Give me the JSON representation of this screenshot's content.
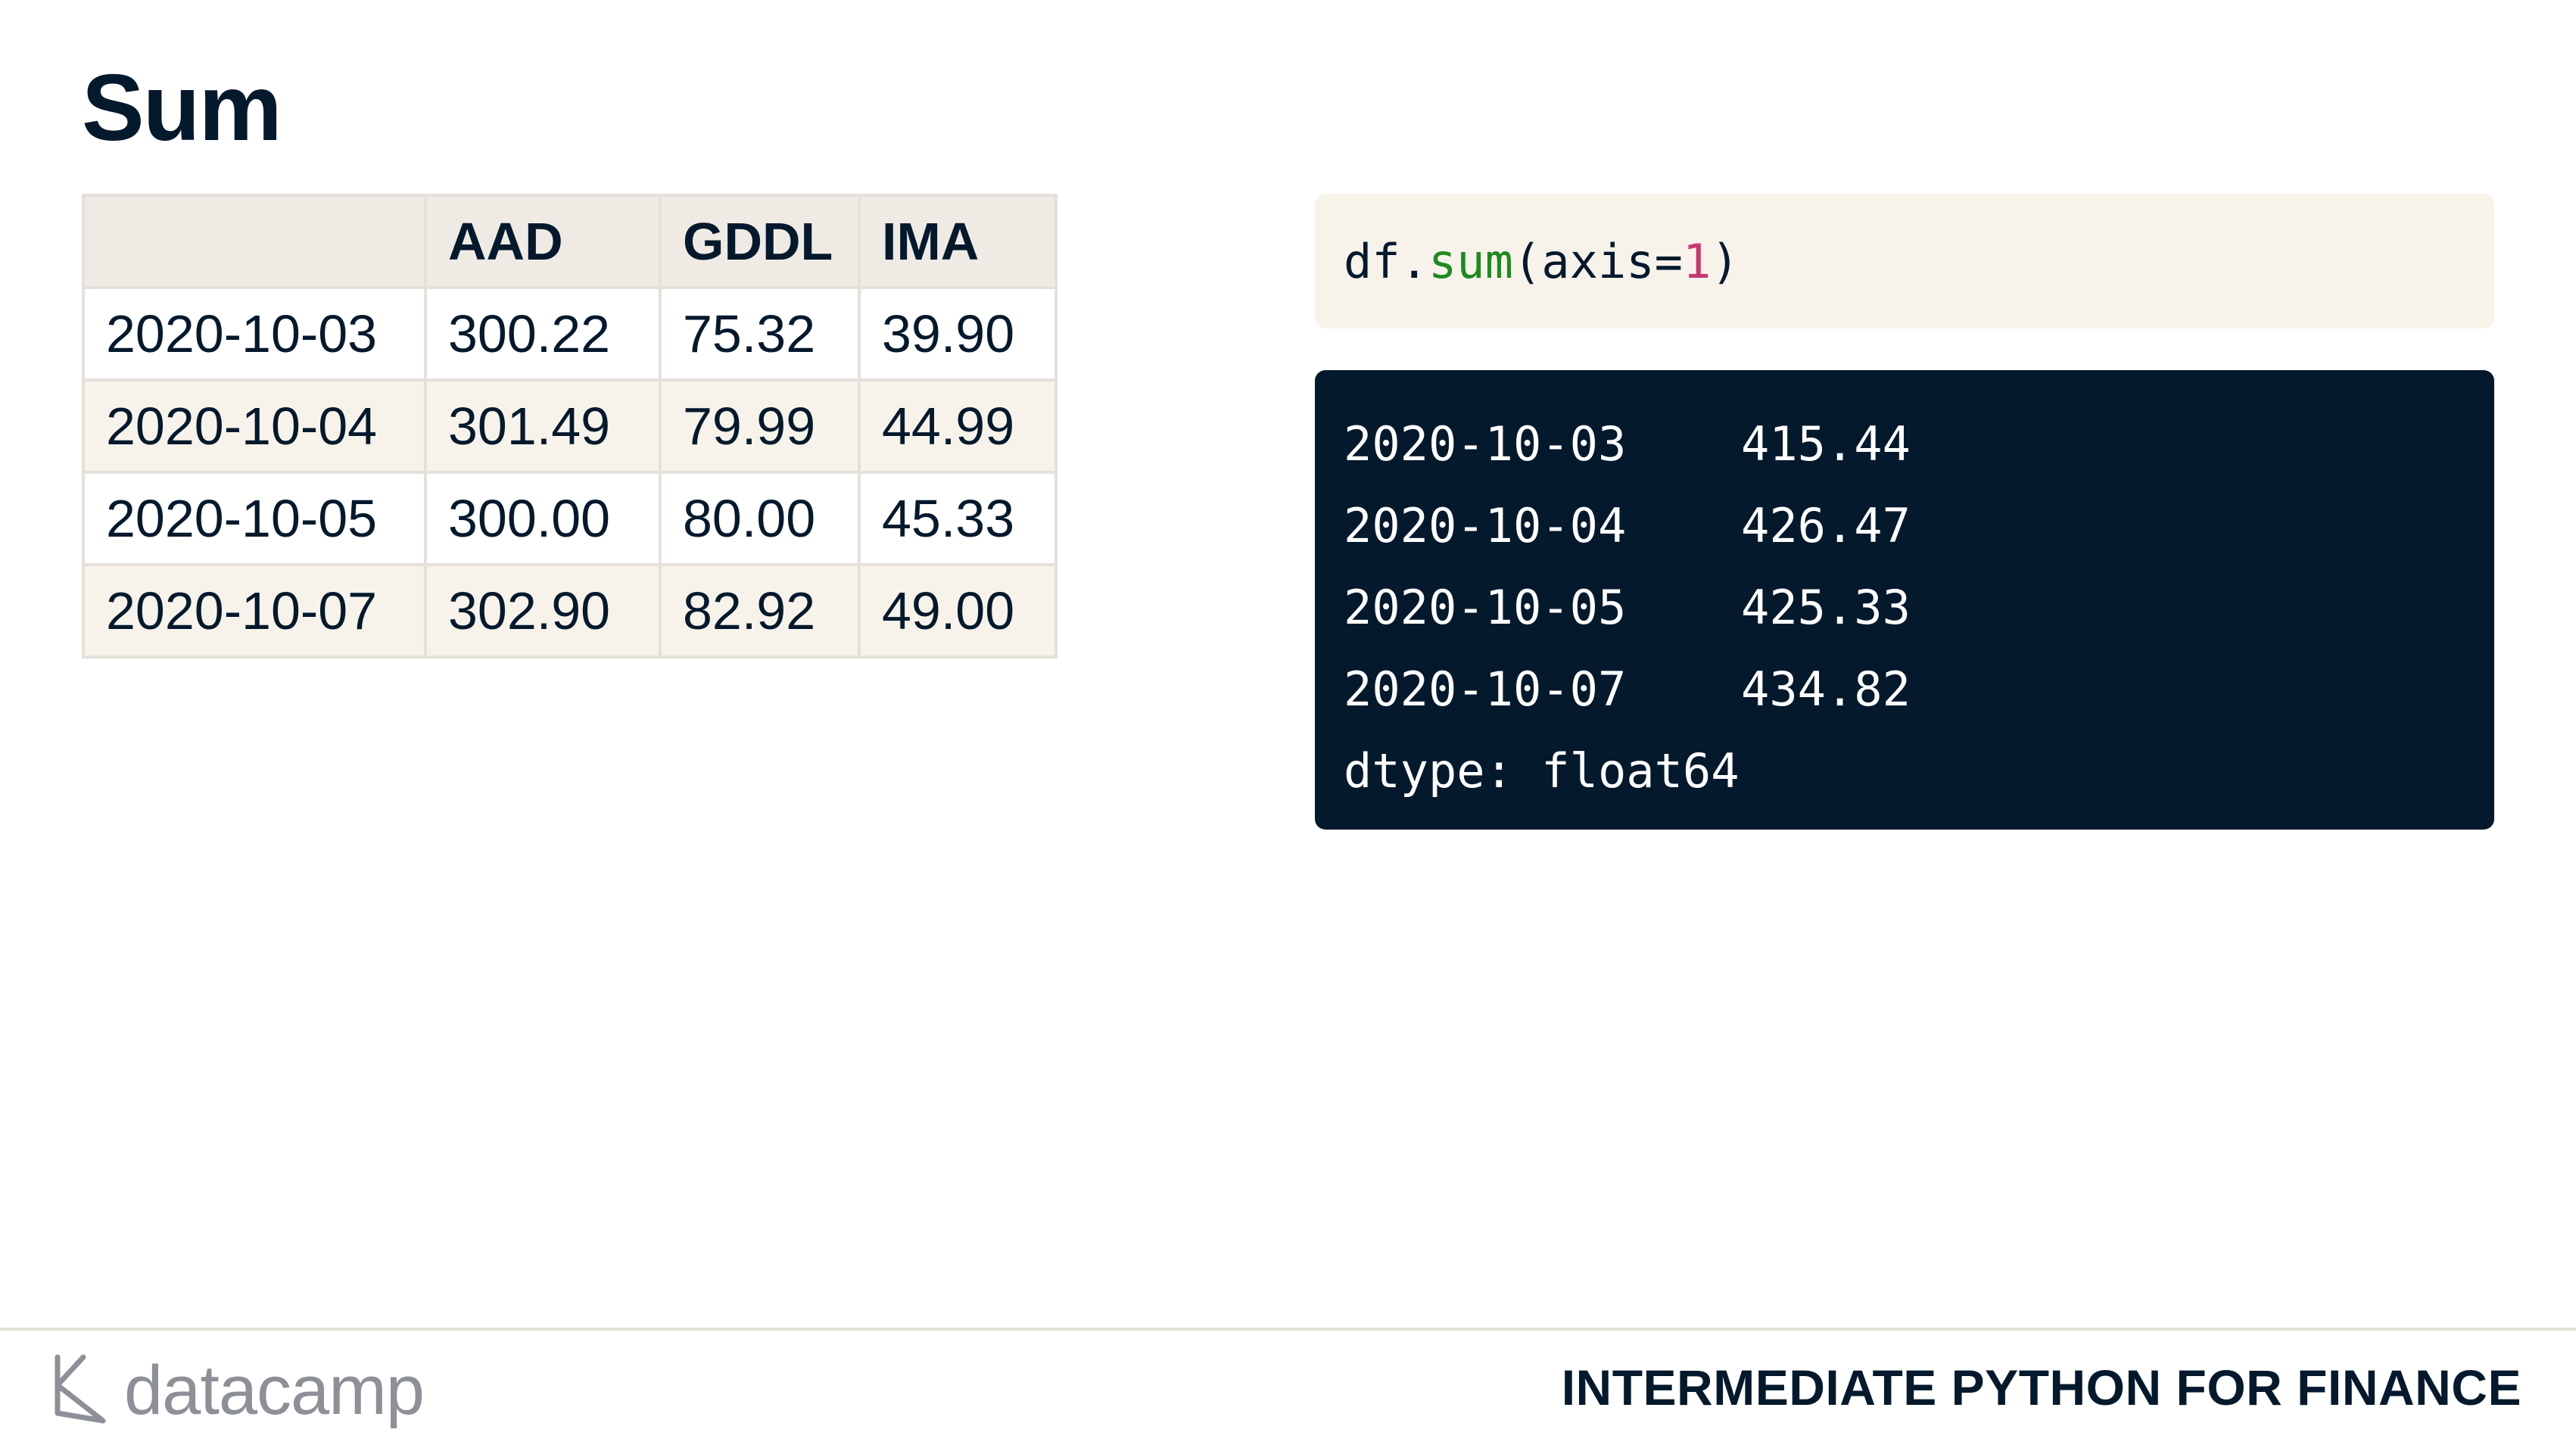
{
  "slide": {
    "title": "Sum"
  },
  "table": {
    "headers": [
      "",
      "AAD",
      "GDDL",
      "IMA"
    ],
    "rows": [
      [
        "2020-10-03",
        "300.22",
        "75.32",
        "39.90"
      ],
      [
        "2020-10-04",
        "301.49",
        "79.99",
        "44.99"
      ],
      [
        "2020-10-05",
        "300.00",
        "80.00",
        "45.33"
      ],
      [
        "2020-10-07",
        "302.90",
        "82.92",
        "49.00"
      ]
    ]
  },
  "code": {
    "object": "df",
    "dot": ".",
    "function": "sum",
    "open": "(axis=",
    "arg_value": "1",
    "close": ")"
  },
  "output": {
    "rows": [
      {
        "date": "2020-10-03",
        "value": "415.44"
      },
      {
        "date": "2020-10-04",
        "value": "426.47"
      },
      {
        "date": "2020-10-05",
        "value": "425.33"
      },
      {
        "date": "2020-10-07",
        "value": "434.82"
      }
    ],
    "dtype": "dtype: float64"
  },
  "footer": {
    "logo_text": "datacamp",
    "course_title": "INTERMEDIATE PYTHON FOR FINANCE"
  },
  "colors": {
    "navy": "#05192d",
    "code_bg": "#f7f3eb",
    "function_green": "#1f8a1f",
    "number_pink": "#c8386e"
  }
}
